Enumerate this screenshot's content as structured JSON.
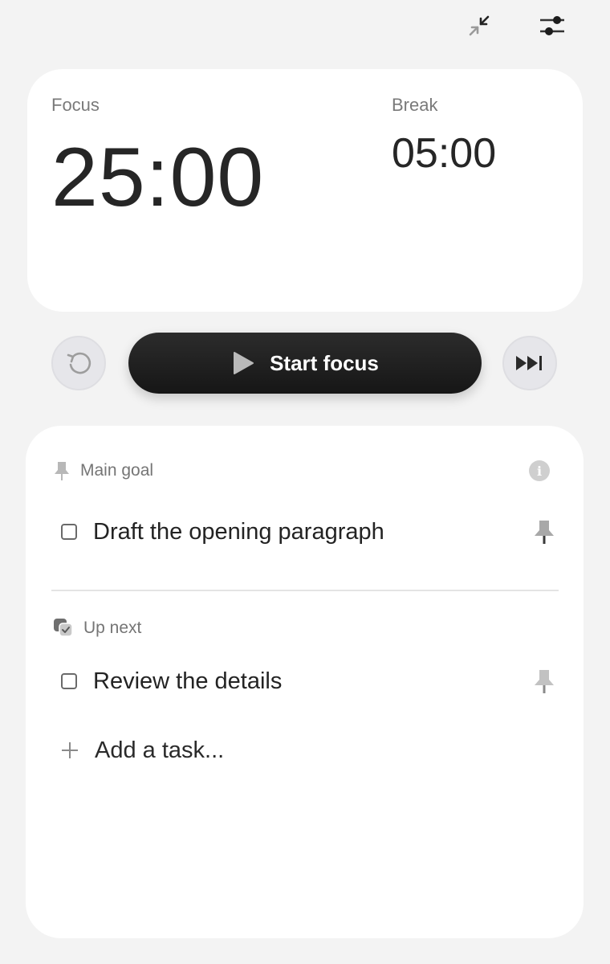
{
  "toolbar": {
    "collapse_icon": "collapse-arrows-icon",
    "settings_icon": "sliders-icon"
  },
  "timer": {
    "focus_label": "Focus",
    "focus_time": "25:00",
    "break_label": "Break",
    "break_time": "05:00"
  },
  "controls": {
    "reset_icon": "reset-icon",
    "start_label": "Start focus",
    "skip_icon": "skip-forward-icon"
  },
  "main_goal": {
    "title": "Main goal",
    "tasks": [
      {
        "text": "Draft the opening paragraph",
        "checked": false
      }
    ]
  },
  "up_next": {
    "title": "Up next",
    "tasks": [
      {
        "text": "Review the details",
        "checked": false
      }
    ]
  },
  "add_task": {
    "placeholder": "Add a task..."
  },
  "colors": {
    "background": "#f3f3f3",
    "card": "#ffffff",
    "primary_button": "#1e1e1e",
    "muted_icon": "#b5b5b5"
  }
}
